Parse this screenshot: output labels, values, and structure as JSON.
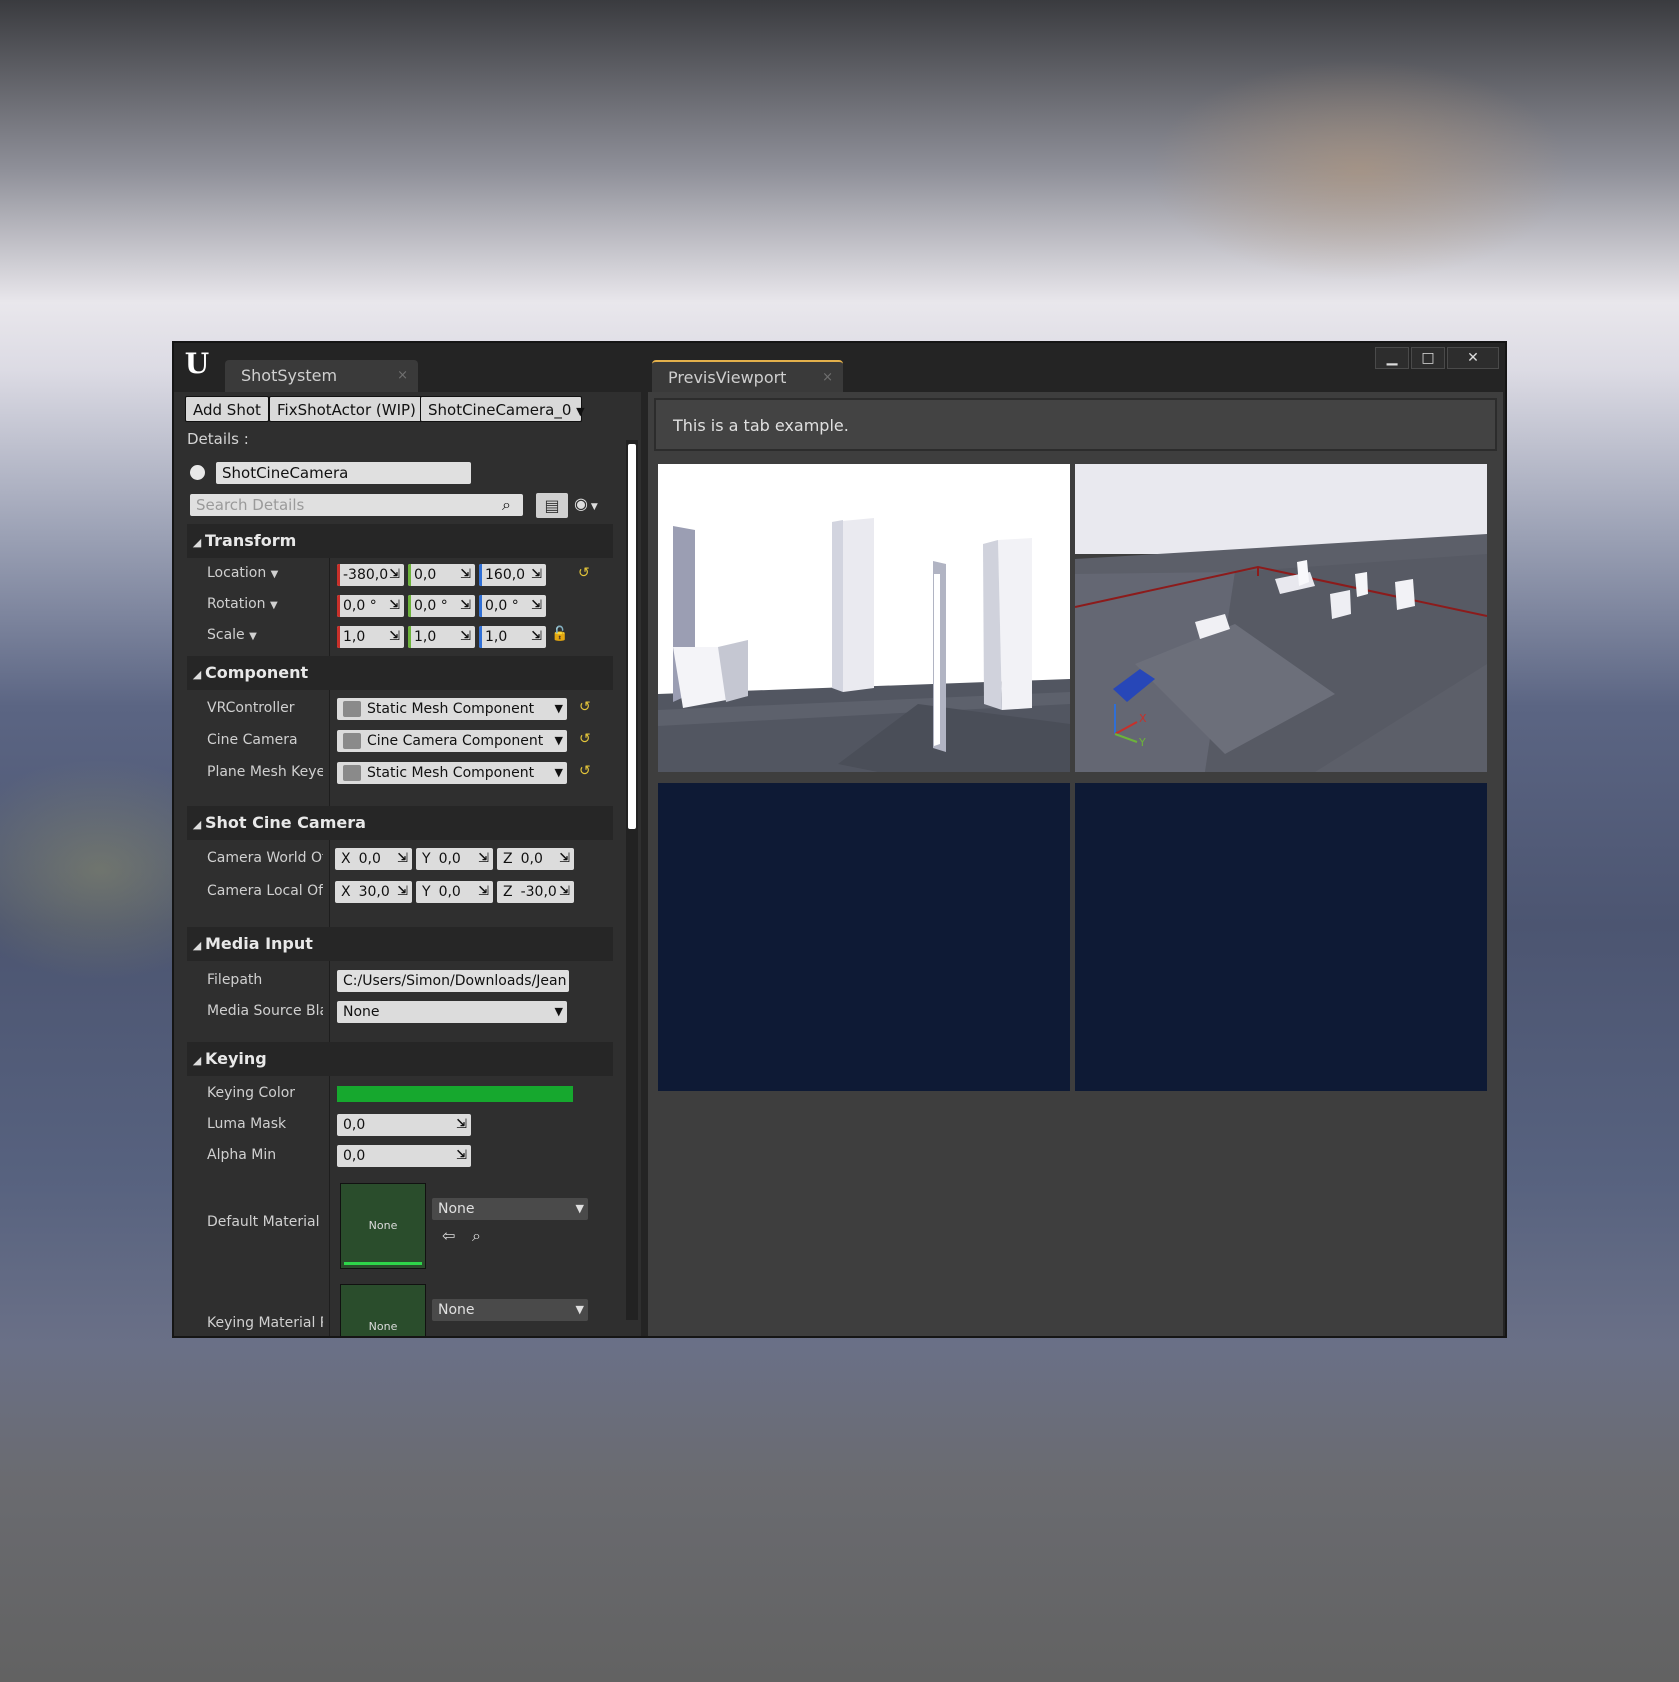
{
  "window": {
    "tabs": [
      {
        "label": "ShotSystem",
        "close": "×"
      },
      {
        "label": "PrevisViewport",
        "close": "×"
      }
    ],
    "controls": {
      "minimize": "▁",
      "maximize": "□",
      "close": "✕"
    }
  },
  "toolbar": {
    "add_shot": "Add Shot",
    "fix_shot": "FixShotActor (WIP)",
    "camera_select": "ShotCineCamera_0"
  },
  "details": {
    "label": "Details :",
    "actor_name": "ShotCineCamera",
    "search_placeholder": "Search Details"
  },
  "sections": {
    "transform": {
      "title": "Transform",
      "location": {
        "label": "Location",
        "x": "-380,0",
        "y": "0,0",
        "z": "160,0"
      },
      "rotation": {
        "label": "Rotation",
        "x": "0,0 °",
        "y": "0,0 °",
        "z": "0,0 °"
      },
      "scale": {
        "label": "Scale",
        "x": "1,0",
        "y": "1,0",
        "z": "1,0"
      }
    },
    "component": {
      "title": "Component",
      "rows": [
        {
          "label": "VRController",
          "value": "Static Mesh Component"
        },
        {
          "label": "Cine Camera",
          "value": "Cine Camera Component"
        },
        {
          "label": "Plane Mesh Keyer",
          "value": "Static Mesh Component"
        }
      ]
    },
    "shot_cine_camera": {
      "title": "Shot Cine Camera",
      "world_offset": {
        "label": "Camera World Offs",
        "x": "0,0",
        "y": "0,0",
        "z": "0,0"
      },
      "local_offset": {
        "label": "Camera Local Offs",
        "x": "30,0",
        "y": "0,0",
        "z": "-30,0"
      },
      "axes": {
        "x": "X",
        "y": "Y",
        "z": "Z"
      }
    },
    "media_input": {
      "title": "Media Input",
      "filepath_label": "Filepath",
      "filepath_value": "C:/Users/Simon/Downloads/Jean",
      "media_source_label": "Media Source Blac",
      "media_source_value": "None"
    },
    "keying": {
      "title": "Keying",
      "color_label": "Keying Color",
      "color": "#16a82e",
      "luma_label": "Luma Mask",
      "luma_value": "0,0",
      "alpha_label": "Alpha Min",
      "alpha_value": "0,0",
      "default_material_label": "Default Material",
      "default_material_thumb": "None",
      "default_material_value": "None",
      "keying_material_label": "Keying Material Pr",
      "keying_material_thumb": "None",
      "keying_material_value": "None"
    }
  },
  "previs": {
    "tab_text": "This is a tab example.",
    "gizmo": {
      "x": "X",
      "y": "Y"
    }
  },
  "colors": {
    "axis_x": "#c8302a",
    "axis_y": "#6cb33a",
    "axis_z": "#2f6fd6",
    "reset": "#e3c53a",
    "viewport_empty": "#0e1a35"
  }
}
